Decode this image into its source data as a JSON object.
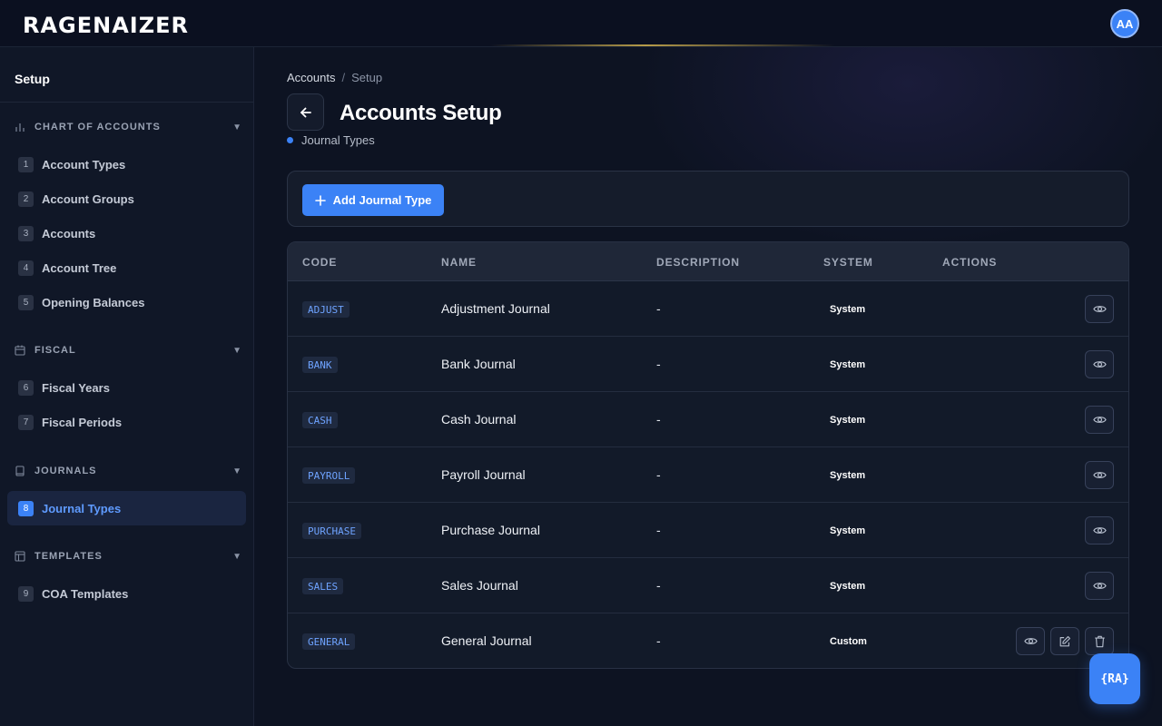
{
  "header": {
    "logo_text": "RAGENAIZER",
    "avatar_initials": "AA"
  },
  "sidebar": {
    "title": "Setup",
    "sections": [
      {
        "label": "CHART OF ACCOUNTS",
        "icon": "bar-chart-icon",
        "items": [
          {
            "num": "1",
            "label": "Account Types"
          },
          {
            "num": "2",
            "label": "Account Groups"
          },
          {
            "num": "3",
            "label": "Accounts"
          },
          {
            "num": "4",
            "label": "Account Tree"
          },
          {
            "num": "5",
            "label": "Opening Balances"
          }
        ]
      },
      {
        "label": "FISCAL",
        "icon": "calendar-icon",
        "items": [
          {
            "num": "6",
            "label": "Fiscal Years"
          },
          {
            "num": "7",
            "label": "Fiscal Periods"
          }
        ]
      },
      {
        "label": "JOURNALS",
        "icon": "book-icon",
        "items": [
          {
            "num": "8",
            "label": "Journal Types",
            "active": true
          }
        ]
      },
      {
        "label": "TEMPLATES",
        "icon": "layout-icon",
        "items": [
          {
            "num": "9",
            "label": "COA Templates"
          }
        ]
      }
    ]
  },
  "breadcrumb": {
    "items": [
      "Accounts",
      "Setup"
    ],
    "separator": "/"
  },
  "page": {
    "title": "Accounts Setup",
    "subtitle": "Journal Types"
  },
  "toolbar": {
    "add_label": "Add Journal Type"
  },
  "table": {
    "columns": [
      "CODE",
      "NAME",
      "DESCRIPTION",
      "SYSTEM",
      "ACTIONS"
    ],
    "rows": [
      {
        "code": "ADJUST",
        "name": "Adjustment Journal",
        "description": "-",
        "system": "System",
        "actions": [
          "view"
        ]
      },
      {
        "code": "BANK",
        "name": "Bank Journal",
        "description": "-",
        "system": "System",
        "actions": [
          "view"
        ]
      },
      {
        "code": "CASH",
        "name": "Cash Journal",
        "description": "-",
        "system": "System",
        "actions": [
          "view"
        ]
      },
      {
        "code": "PAYROLL",
        "name": "Payroll Journal",
        "description": "-",
        "system": "System",
        "actions": [
          "view"
        ]
      },
      {
        "code": "PURCHASE",
        "name": "Purchase Journal",
        "description": "-",
        "system": "System",
        "actions": [
          "view"
        ]
      },
      {
        "code": "SALES",
        "name": "Sales Journal",
        "description": "-",
        "system": "System",
        "actions": [
          "view"
        ]
      },
      {
        "code": "GENERAL",
        "name": "General Journal",
        "description": "-",
        "system": "Custom",
        "actions": [
          "view",
          "edit",
          "delete"
        ]
      }
    ]
  },
  "fab": {
    "icon": "assistant-icon",
    "label": "{RA}"
  },
  "colors": {
    "accent": "#3b82f6",
    "code_text": "#6ea3ff",
    "background": "#0d1322"
  }
}
